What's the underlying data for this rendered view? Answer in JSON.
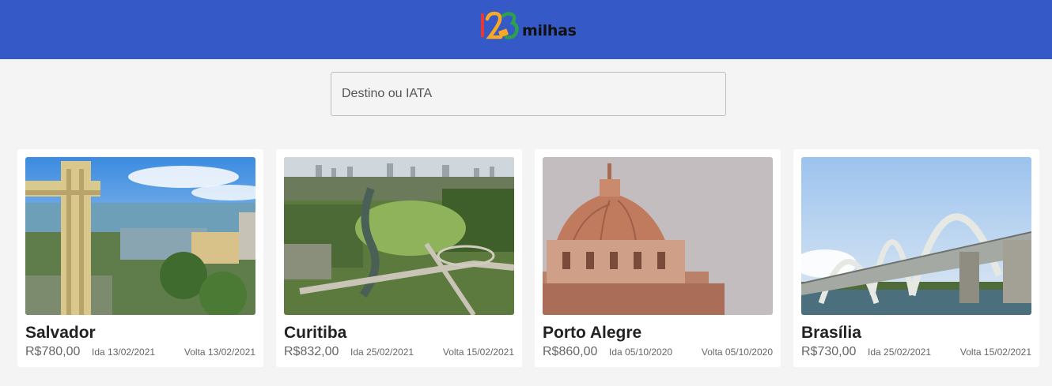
{
  "header": {
    "logo_text": "milhas",
    "logo_digits": "123",
    "brand_color": "#3559c7"
  },
  "search": {
    "placeholder": "Destino ou IATA",
    "value": ""
  },
  "destinations": [
    {
      "city": "Salvador",
      "price": "R$780,00",
      "ida": "Ida 13/02/2021",
      "volta": "Volta 13/02/2021",
      "image": "salvador-elevator-photo"
    },
    {
      "city": "Curitiba",
      "price": "R$832,00",
      "ida": "Ida 25/02/2021",
      "volta": "Volta 15/02/2021",
      "image": "curitiba-park-aerial-photo"
    },
    {
      "city": "Porto Alegre",
      "price": "R$860,00",
      "ida": "Ida 05/10/2020",
      "volta": "Volta 05/10/2020",
      "image": "porto-alegre-cathedral-dome-photo"
    },
    {
      "city": "Brasília",
      "price": "R$730,00",
      "ida": "Ida 25/02/2021",
      "volta": "Volta 15/02/2021",
      "image": "brasilia-bridge-photo"
    }
  ]
}
